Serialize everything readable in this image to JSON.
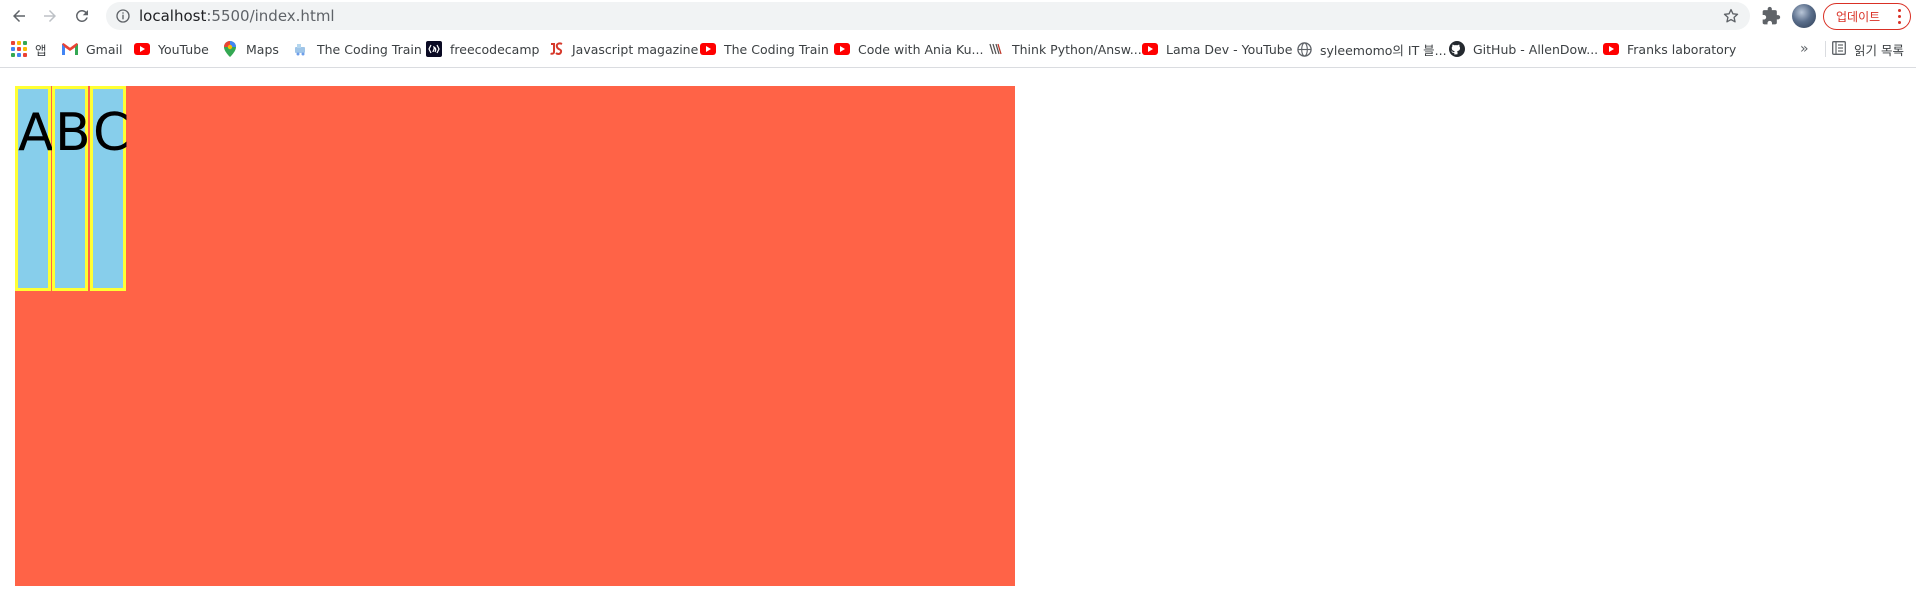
{
  "browser": {
    "url_host": "localhost",
    "url_path": ":5500/index.html",
    "update_label": "업데이트",
    "reading_list_label": "읽기 목록",
    "more_label": "»"
  },
  "bookmarks": [
    {
      "label": "앱",
      "icon": "apps-grid-icon"
    },
    {
      "label": "Gmail",
      "icon": "gmail-icon"
    },
    {
      "label": "YouTube",
      "icon": "youtube-icon"
    },
    {
      "label": "Maps",
      "icon": "maps-pin-icon"
    },
    {
      "label": "The Coding Train",
      "icon": "coding-train-icon"
    },
    {
      "label": "freecodecamp",
      "icon": "freecodecamp-icon"
    },
    {
      "label": "Javascript magazine",
      "icon": "js-magazine-icon"
    },
    {
      "label": "The Coding Train",
      "icon": "youtube-icon"
    },
    {
      "label": "Code with Ania Ku...",
      "icon": "youtube-icon"
    },
    {
      "label": "Think Python/Answ...",
      "icon": "think-python-icon"
    },
    {
      "label": "Lama Dev - YouTube",
      "icon": "youtube-icon"
    },
    {
      "label": "syleemomo의 IT 블...",
      "icon": "globe-icon"
    },
    {
      "label": "GitHub - AllenDow...",
      "icon": "github-icon"
    },
    {
      "label": "Franks laboratory",
      "icon": "youtube-icon"
    }
  ],
  "page": {
    "items": [
      "A",
      "B",
      "C"
    ]
  },
  "colors": {
    "container": "#ff6347",
    "item_fill": "#87ceeb",
    "item_border": "#ffff33",
    "update_accent": "#d93025"
  }
}
